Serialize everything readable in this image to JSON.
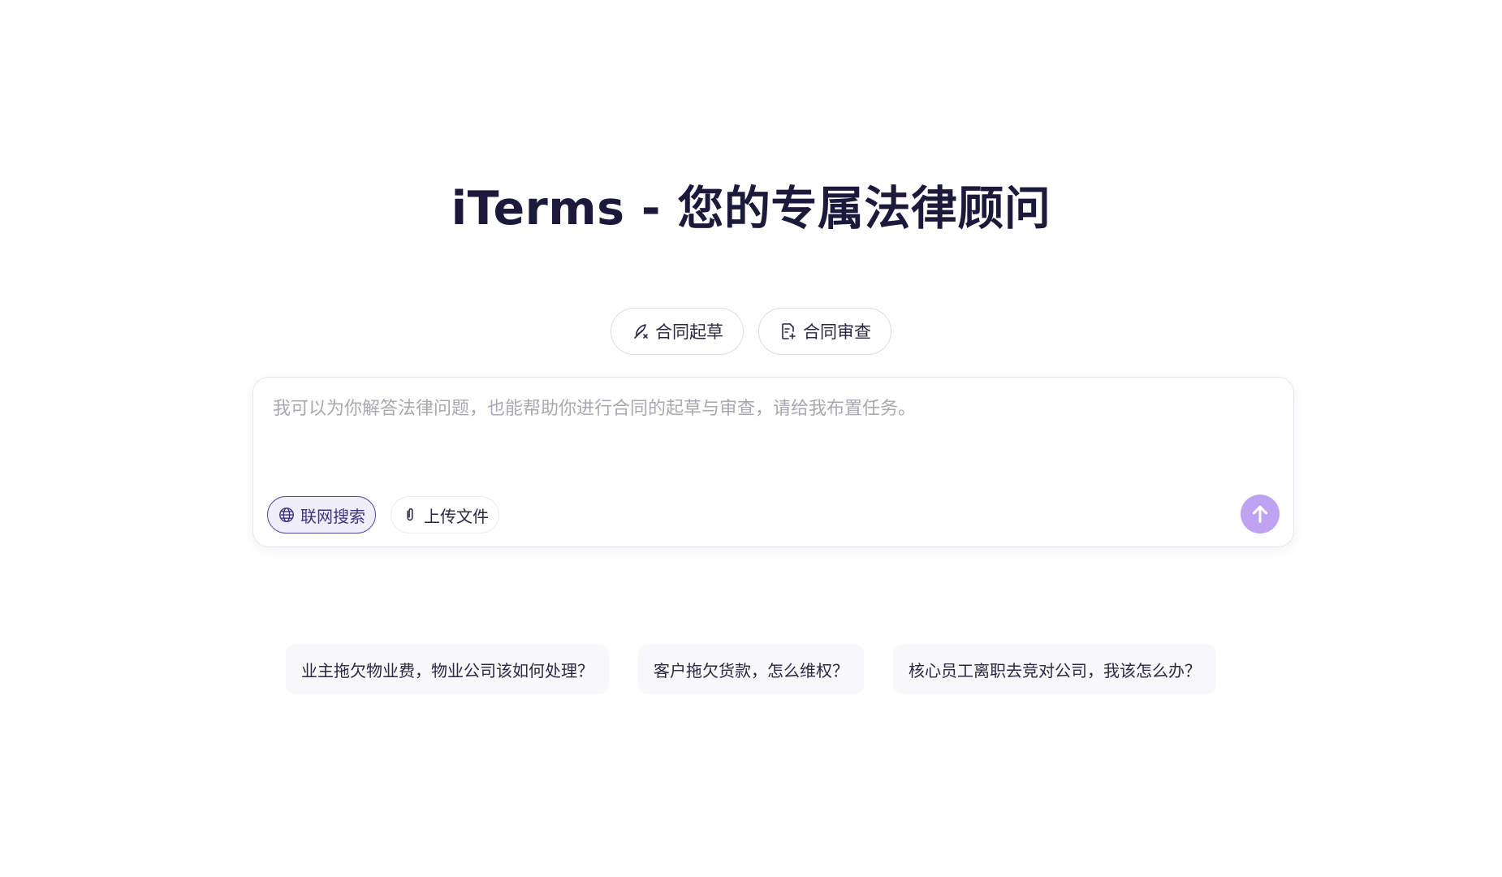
{
  "title": "iTerms - 您的专属法律顾问",
  "modes": [
    {
      "label": "合同起草",
      "icon": "feather-pen-icon"
    },
    {
      "label": "合同审查",
      "icon": "document-review-icon"
    }
  ],
  "composer": {
    "placeholder": "我可以为你解答法律问题，也能帮助你进行合同的起草与审查，请给我布置任务。",
    "value": "",
    "tools": [
      {
        "label": "联网搜索",
        "icon": "globe-icon",
        "active": true
      },
      {
        "label": "上传文件",
        "icon": "paperclip-icon",
        "active": false
      }
    ],
    "send_icon": "arrow-up-icon"
  },
  "suggestions": [
    "业主拖欠物业费，物业公司该如何处理？",
    "客户拖欠货款，怎么维权？",
    "核心员工离职去竞对公司，我该怎么办？"
  ],
  "colors": {
    "accent": "#c0a2f3",
    "active_border": "#5b4aa3",
    "active_bg": "#f1eefc",
    "title": "#1c1a3b"
  }
}
